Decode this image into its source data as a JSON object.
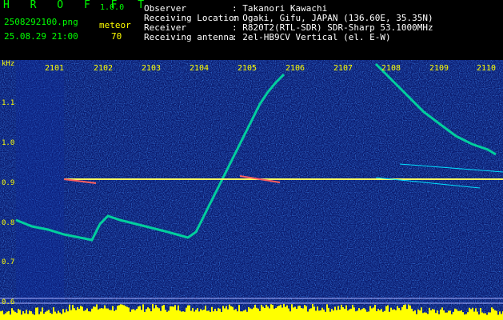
{
  "header": {
    "app_title": "H R O F F T",
    "version": "1.0.0",
    "file_name": "2508292100.png",
    "datetime": "25.08.29 21:00",
    "meteor_label": "meteor",
    "meteor_count": "70",
    "info": [
      {
        "label": "Observer",
        "value": ": Takanori Kawachi"
      },
      {
        "label": "Receiving Location",
        "value": ": Ogaki, Gifu, JAPAN (136.60E, 35.35N)"
      },
      {
        "label": "Receiver",
        "value": ": R820T2(RTL-SDR) SDR-Sharp 53.1000MHz"
      },
      {
        "label": "Receiving antenna",
        "value": ": 2el-HB9CV Vertical (el. E-W)"
      }
    ]
  },
  "spectrogram": {
    "unit_label": "kHz",
    "time_ticks": [
      "2101",
      "2102",
      "2103",
      "2104",
      "2105",
      "2106",
      "2107",
      "2108",
      "2109",
      "2110"
    ],
    "freq_ticks": [
      "1.1",
      "1.0",
      "0.9",
      "0.8",
      "0.7",
      "0.6"
    ],
    "colors": {
      "background": "#0a1a6e",
      "trace": "#00e0a0",
      "carrier": "#ffff60",
      "level": "#ffff00"
    }
  }
}
